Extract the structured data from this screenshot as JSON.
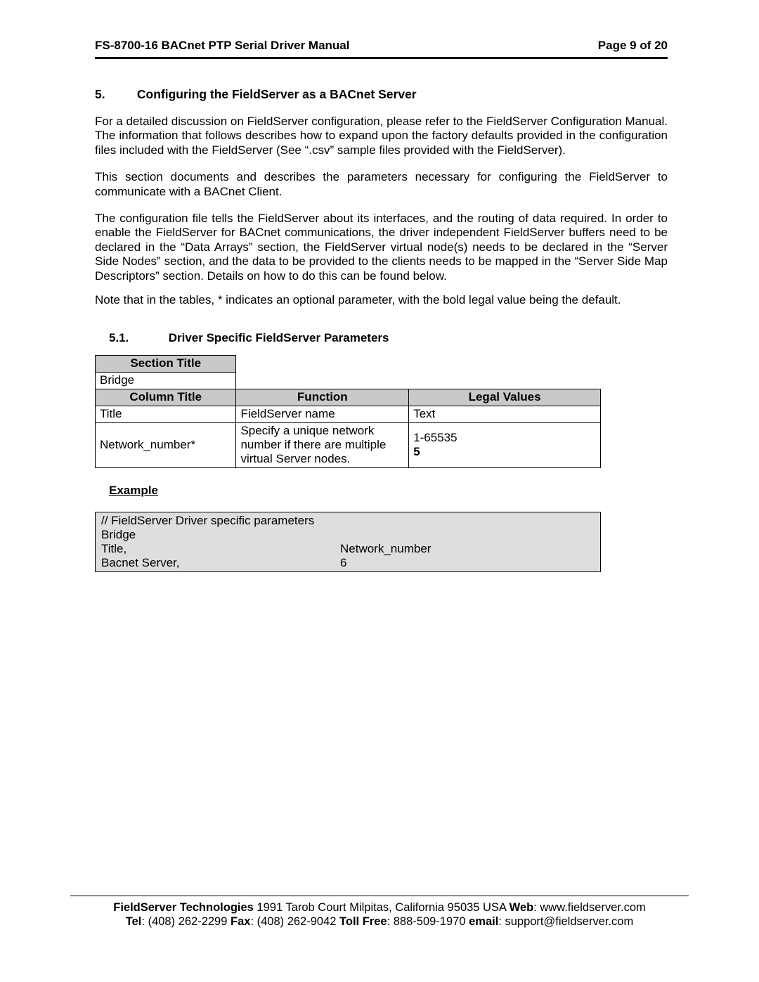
{
  "header": {
    "left": "FS-8700-16 BACnet PTP Serial Driver Manual",
    "right": "Page 9 of 20"
  },
  "section5": {
    "number": "5.",
    "title": "Configuring the FieldServer as a BACnet Server",
    "p1": "For a detailed discussion on FieldServer configuration, please refer to the FieldServer Configuration Manual. The information that follows describes how to expand upon the factory defaults provided in the configuration files included with the FieldServer (See “.csv” sample files provided with the FieldServer).",
    "p2": "This section documents and describes the parameters necessary for configuring the FieldServer to communicate with a BACnet Client.",
    "p3": "The configuration file tells the FieldServer about its interfaces, and the routing of data required. In order to enable the FieldServer for BACnet communications, the driver independent FieldServer buffers need to be declared in the “Data Arrays” section, the FieldServer virtual node(s) needs to be declared in the “Server Side Nodes” section, and the data to be provided to the clients needs to be mapped in the “Server Side Map Descriptors” section. Details on how to do this can be found below.",
    "p4": "Note that in the tables, * indicates an optional parameter, with the bold legal value being the default."
  },
  "section51": {
    "number": "5.1.",
    "title": "Driver Specific FieldServer Parameters",
    "table": {
      "sectionTitleHeader": "Section Title",
      "bridgeRow": "Bridge",
      "headers": {
        "col": "Column Title",
        "func": "Function",
        "legal": "Legal Values"
      },
      "rows": [
        {
          "col": "Title",
          "func": "FieldServer name",
          "legal": "Text",
          "default": ""
        },
        {
          "col": "Network_number*",
          "func": "Specify a unique network number if there are multiple virtual Server nodes.",
          "legal": "1-65535",
          "default": "5"
        }
      ]
    },
    "exampleLabel": "Example",
    "example": {
      "l1": "//    FieldServer Driver specific parameters",
      "l2": "Bridge",
      "l3a": "Title,",
      "l3b": "Network_number",
      "l4a": "Bacnet Server,",
      "l4b": "6"
    }
  },
  "footer": {
    "company": "FieldServer Technologies",
    "addr": " 1991 Tarob Court Milpitas, California 95035 USA   ",
    "webLabel": "Web",
    "webVal": ": www.fieldserver.com",
    "telLabel": "Tel",
    "telVal": ": (408) 262-2299   ",
    "faxLabel": "Fax",
    "faxVal": ": (408) 262-9042   ",
    "tollLabel": "Toll Free",
    "tollVal": ": 888-509-1970   ",
    "emailLabel": "email",
    "emailVal": ": support@fieldserver.com"
  }
}
